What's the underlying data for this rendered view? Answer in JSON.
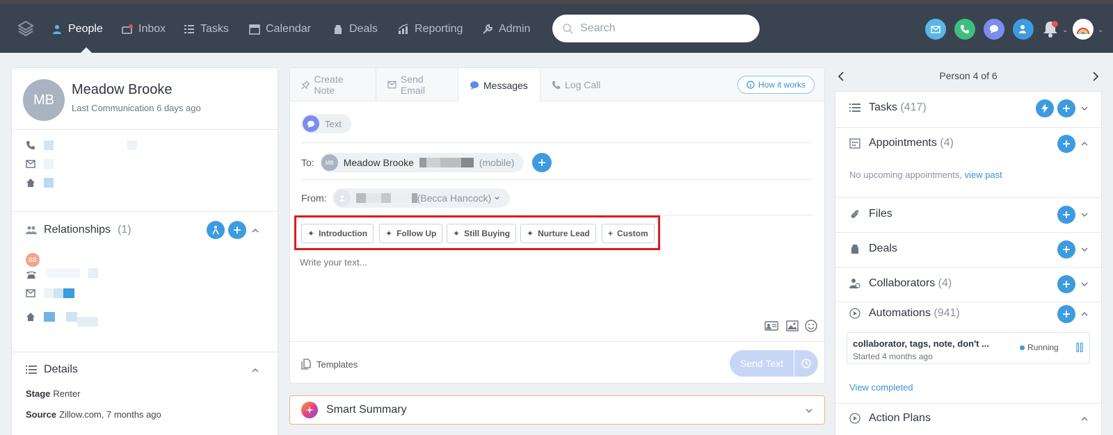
{
  "nav": {
    "items": [
      {
        "label": "People",
        "icon": "people-icon"
      },
      {
        "label": "Inbox",
        "icon": "inbox-icon"
      },
      {
        "label": "Tasks",
        "icon": "tasks-icon"
      },
      {
        "label": "Calendar",
        "icon": "calendar-icon"
      },
      {
        "label": "Deals",
        "icon": "deals-icon"
      },
      {
        "label": "Reporting",
        "icon": "reporting-icon"
      },
      {
        "label": "Admin",
        "icon": "admin-icon"
      }
    ],
    "active": "People",
    "search_placeholder": "Search",
    "quick_actions": [
      {
        "icon": "email-icon",
        "color": "#5ab6e9"
      },
      {
        "icon": "phone-icon",
        "color": "#3fbf7f"
      },
      {
        "icon": "message-icon",
        "color": "#7c8df0"
      },
      {
        "icon": "add-person-icon",
        "color": "#3d9be0"
      }
    ]
  },
  "person": {
    "initials": "MB",
    "name": "Meadow Brooke",
    "last_communication": "Last Communication 6 days ago"
  },
  "relationships": {
    "title": "Relationships",
    "count": "(1)",
    "member_initials": "BB"
  },
  "details": {
    "title": "Details",
    "stage_label": "Stage",
    "stage_value": "Renter",
    "source_label": "Source",
    "source_value": "Zillow.com, 7 months ago"
  },
  "composer": {
    "tabs": [
      {
        "label": "Create Note",
        "icon": "pin-icon"
      },
      {
        "label": "Send Email",
        "icon": "email-icon"
      },
      {
        "label": "Messages",
        "icon": "message-icon"
      },
      {
        "label": "Log Call",
        "icon": "phone-icon"
      }
    ],
    "active_tab": "Messages",
    "how_it_works": "How it works",
    "channel": "Text",
    "to_label": "To:",
    "to_initials": "MB",
    "to_name": "Meadow Brooke",
    "to_type": "(mobile)",
    "from_label": "From:",
    "from_name": "(Becca Hancock)",
    "ai_templates": [
      "Introduction",
      "Follow Up",
      "Still Buying",
      "Nurture Lead"
    ],
    "custom_label": "Custom",
    "placeholder": "Write your text...",
    "templates_label": "Templates",
    "send_label": "Send Text"
  },
  "smart_summary": {
    "label": "Smart Summary"
  },
  "right": {
    "pager": "Person 4 of 6",
    "sections": {
      "tasks": {
        "label": "Tasks",
        "count": "(417)"
      },
      "appointments": {
        "label": "Appointments",
        "count": "(4)"
      },
      "no_appointments": "No upcoming appointments,",
      "view_past": "view past",
      "files": {
        "label": "Files"
      },
      "deals": {
        "label": "Deals"
      },
      "collaborators": {
        "label": "Collaborators",
        "count": "(4)"
      },
      "automations": {
        "label": "Automations",
        "count": "(941)"
      },
      "action_plans": {
        "label": "Action Plans"
      }
    },
    "automation_card": {
      "title": "collaborator, tags, note, don't ...",
      "started": "Started 4 months ago",
      "status": "Running"
    },
    "view_completed": "View completed"
  }
}
